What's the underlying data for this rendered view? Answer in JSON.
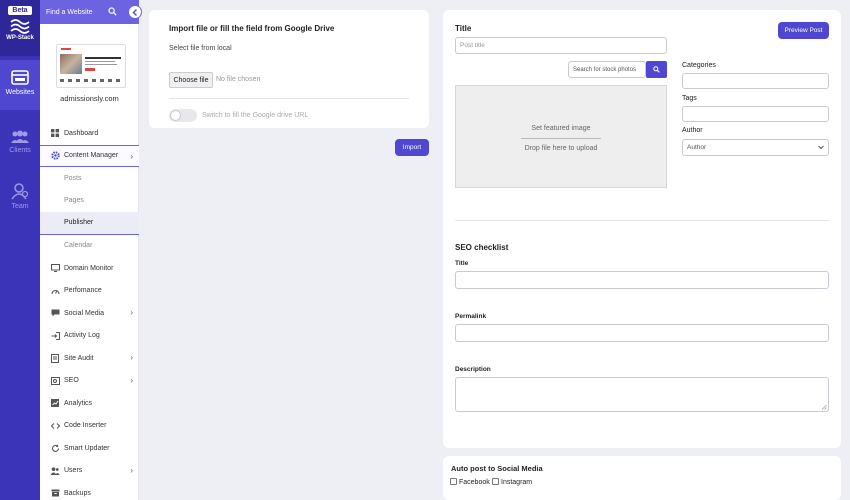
{
  "rail": {
    "beta": "Beta",
    "brand": "WP-Stack",
    "items": [
      {
        "label": "Websites"
      },
      {
        "label": "Clients"
      },
      {
        "label": "Team"
      }
    ]
  },
  "sidebar": {
    "search_label": "Find a Website",
    "site_name": "admissionsly.com",
    "nav": [
      {
        "label": "Dashboard"
      },
      {
        "label": "Content Manager"
      },
      {
        "label": "Posts"
      },
      {
        "label": "Pages"
      },
      {
        "label": "Publisher"
      },
      {
        "label": "Calendar"
      },
      {
        "label": "Domain Monitor"
      },
      {
        "label": "Perfomance"
      },
      {
        "label": "Social Media"
      },
      {
        "label": "Activity Log"
      },
      {
        "label": "Site Audit"
      },
      {
        "label": "SEO"
      },
      {
        "label": "Analytics"
      },
      {
        "label": "Code Inserter"
      },
      {
        "label": "Smart Updater"
      },
      {
        "label": "Users"
      },
      {
        "label": "Backups"
      }
    ]
  },
  "import_card": {
    "title": "Import file or fill the field from Google Drive",
    "select_label": "Select file from local",
    "choose_label": "Choose file",
    "no_file": "No file chosen",
    "switch_label": "Switch to fill the Google drive URL",
    "import_button": "Import"
  },
  "editor": {
    "title_label": "Title",
    "preview_button": "Preview Post",
    "title_placeholder": "Post title",
    "stock_placeholder": "Search for stock photos",
    "featured_label": "Set featured image",
    "drop_label": "Drop file here to upload",
    "categories_label": "Categories",
    "tags_label": "Tags",
    "author_label": "Author",
    "author_value": "Author",
    "seo_title": "SEO checklist",
    "seo_fields": {
      "title": "Title",
      "permalink": "Permalink",
      "description": "Description"
    }
  },
  "social": {
    "title": "Auto post to Social Media",
    "facebook": "Facebook",
    "instagram": "Instagram"
  },
  "colors": {
    "rail": "#3b34b8",
    "accent": "#4f47d0",
    "search_bar": "#6c63e0"
  }
}
